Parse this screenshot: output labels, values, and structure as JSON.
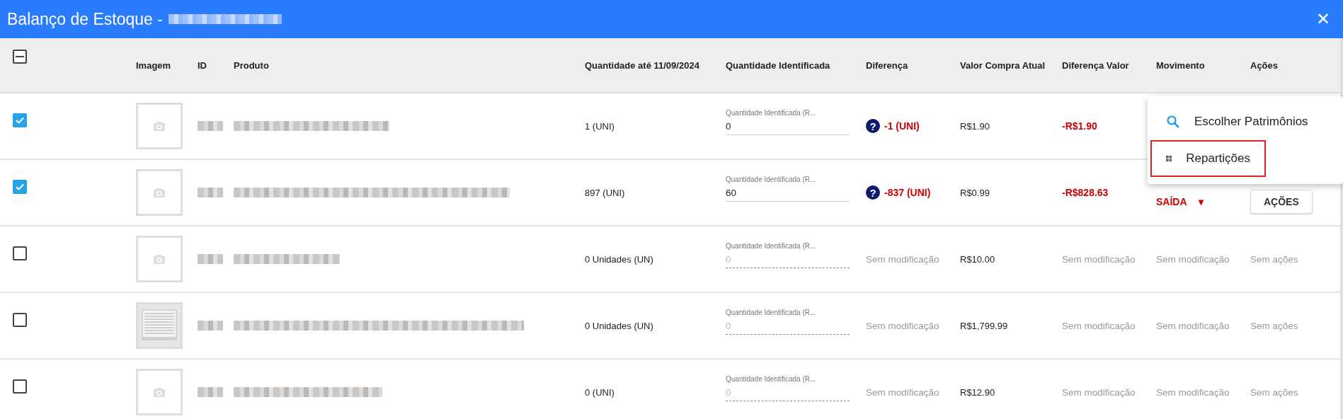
{
  "window": {
    "title": "Balanço de Estoque -",
    "title_redacted": true,
    "close": "✕"
  },
  "table": {
    "select_all": {
      "indeterminate": true
    },
    "columns": [
      "Imagem",
      "ID",
      "Produto",
      "Quantidade até 11/09/2024",
      "Quantidade Identificada",
      "Diferença",
      "Valor Compra Atual",
      "Diferença Valor",
      "Movimento",
      "Ações"
    ],
    "rows": [
      {
        "checked": true,
        "image": {
          "kind": "placeholder"
        },
        "quantity": "1 (UNI)",
        "field": {
          "label": "Quantidade Identificada (R...",
          "value": "0",
          "disabled": false
        },
        "difference": {
          "kind": "change",
          "text": "-1 (UNI)",
          "help": "?"
        },
        "price": "R$1.90",
        "difference_value": {
          "kind": "change",
          "text": "-R$1.90"
        }
      },
      {
        "checked": true,
        "image": {
          "kind": "placeholder"
        },
        "quantity": "897 (UNI)",
        "field": {
          "label": "Quantidade Identificada (R...",
          "value": "60",
          "disabled": false
        },
        "difference": {
          "kind": "change",
          "text": "-837 (UNI)",
          "help": "?"
        },
        "price": "R$0.99",
        "difference_value": {
          "kind": "change",
          "text": "-R$828.63"
        },
        "movement": {
          "kind": "select",
          "text": "SAÍDA",
          "caret": "▾"
        },
        "actions": {
          "kind": "button",
          "text": "AÇÕES"
        }
      },
      {
        "checked": false,
        "image": {
          "kind": "placeholder"
        },
        "quantity": "0 Unidades (UN)",
        "field": {
          "label": "Quantidade Identificada (R...",
          "value": "0",
          "disabled": true
        },
        "difference": {
          "kind": "none",
          "text": "Sem modificação"
        },
        "price": "R$10.00",
        "difference_value": {
          "kind": "none",
          "text": "Sem modificação"
        },
        "movement": {
          "kind": "none",
          "text": "Sem modificação"
        },
        "actions": {
          "kind": "none",
          "text": "Sem ações"
        }
      },
      {
        "checked": false,
        "quantity": "0 Unidades (UN)",
        "field": {
          "label": "Quantidade Identificada (R...",
          "value": "0",
          "disabled": true
        },
        "difference": {
          "kind": "none",
          "text": "Sem modificação"
        },
        "price": "R$1,799.99",
        "difference_value": {
          "kind": "none",
          "text": "Sem modificação"
        },
        "movement": {
          "kind": "none",
          "text": "Sem modificação"
        },
        "actions": {
          "kind": "none",
          "text": "Sem ações"
        }
      },
      {
        "checked": false,
        "image": {
          "kind": "placeholder"
        },
        "quantity": "0 (UNI)",
        "field": {
          "label": "Quantidade Identificada (R...",
          "value": "0",
          "disabled": true
        },
        "difference": {
          "kind": "none",
          "text": "Sem modificação"
        },
        "price": "R$12.90",
        "difference_value": {
          "kind": "none",
          "text": "Sem modificação"
        },
        "movement": {
          "kind": "none",
          "text": "Sem modificação"
        },
        "actions": {
          "kind": "none",
          "text": "Sem ações"
        }
      }
    ]
  },
  "menu": {
    "items": [
      {
        "kind": "search",
        "label": "Escolher Patrimônios",
        "highlighted": false
      },
      {
        "kind": "grid",
        "label": "Repartições",
        "highlighted": true
      }
    ]
  }
}
